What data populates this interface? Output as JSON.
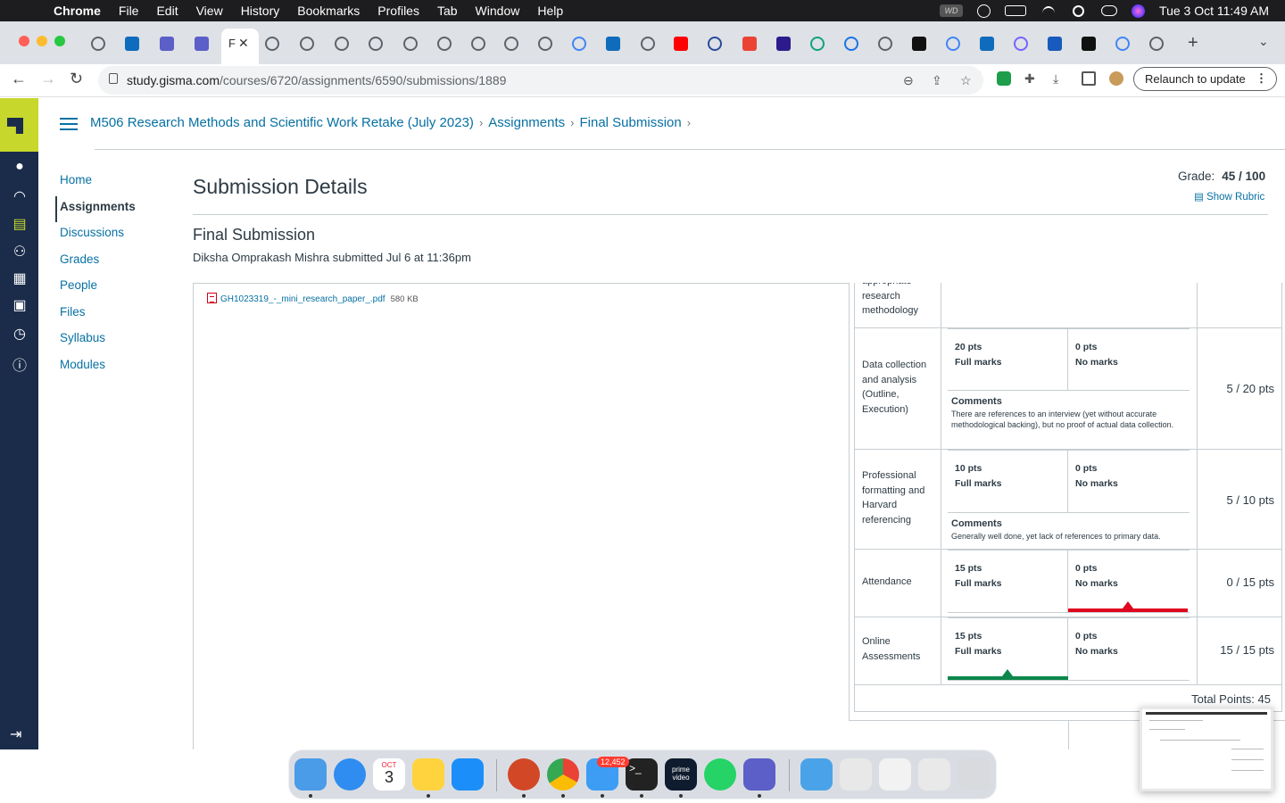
{
  "menubar": {
    "app": "Chrome",
    "items": [
      "File",
      "Edit",
      "View",
      "History",
      "Bookmarks",
      "Profiles",
      "Tab",
      "Window",
      "Help"
    ],
    "datetime": "Tue 3 Oct  11:49 AM"
  },
  "browser": {
    "active_tab_title": "F",
    "url_host": "study.gisma.com",
    "url_path": "/courses/6720/assignments/6590/submissions/1889",
    "relaunch_label": "Relaunch to update"
  },
  "breadcrumb": {
    "course": "M506 Research Methods and Scientific Work Retake (July 2023)",
    "section": "Assignments",
    "page": "Final Submission",
    "separator": "›"
  },
  "course_nav": [
    "Home",
    "Assignments",
    "Discussions",
    "Grades",
    "People",
    "Files",
    "Syllabus",
    "Modules"
  ],
  "main": {
    "title": "Submission Details",
    "grade_label": "Grade:",
    "grade_value": "45 / 100",
    "show_rubric": "Show Rubric",
    "assignment_name": "Final Submission",
    "submitted_text": "Diksha Omprakash Mishra submitted Jul 6 at 11:36pm",
    "file_name": "GH1023319_-_mini_research_paper_.pdf",
    "file_size": "580 KB"
  },
  "rubric": {
    "partial_criterion": "appropriate research methodology",
    "criteria": [
      {
        "name": "Data collection and analysis (Outline, Execution)",
        "full_pts": "20 pts",
        "full_label": "Full marks",
        "none_pts": "0 pts",
        "none_label": "No marks",
        "comments_label": "Comments",
        "comments": "There are references to an interview (yet without accurate methodological backing), but no proof of actual data collection.",
        "score": "5 / 20 pts"
      },
      {
        "name": "Professional formatting and Harvard referencing",
        "full_pts": "10 pts",
        "full_label": "Full marks",
        "none_pts": "0 pts",
        "none_label": "No marks",
        "comments_label": "Comments",
        "comments": "Generally well done, yet lack of references to primary data.",
        "score": "5 / 10 pts"
      },
      {
        "name": "Attendance",
        "full_pts": "15 pts",
        "full_label": "Full marks",
        "none_pts": "0 pts",
        "none_label": "No marks",
        "score": "0 / 15 pts",
        "selected": "none"
      },
      {
        "name": "Online Assessments",
        "full_pts": "15 pts",
        "full_label": "Full marks",
        "none_pts": "0 pts",
        "none_label": "No marks",
        "score": "15 / 15 pts",
        "selected": "full"
      }
    ],
    "total": "Total Points: 45"
  },
  "dock": {
    "calendar_month": "OCT",
    "calendar_day": "3",
    "mail_badge": "12,452",
    "prime_label": "prime video"
  },
  "colors": {
    "canvas_nav": "#1a2c4a",
    "logo_accent": "#c7d72c",
    "link": "#0770a3",
    "selected_none": "#e0061f",
    "selected_full": "#0b874b"
  }
}
